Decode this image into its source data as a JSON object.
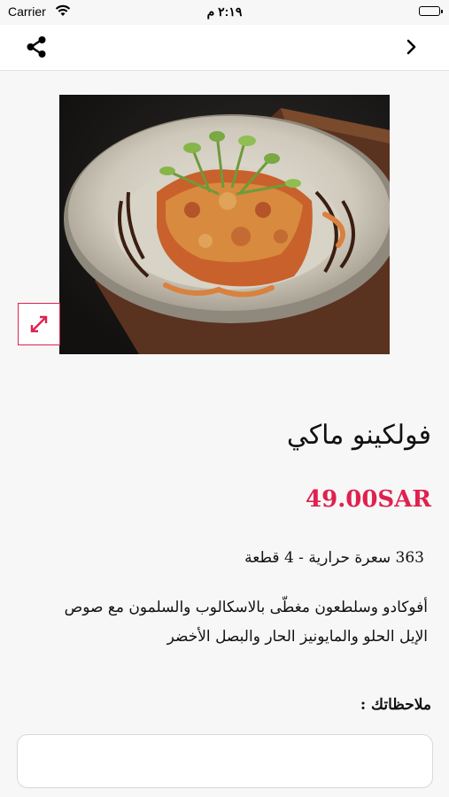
{
  "status_bar": {
    "carrier": "Carrier",
    "time": "٢:١٩ م"
  },
  "nav": {
    "share_icon": "share-icon",
    "forward_icon": "chevron-right-icon"
  },
  "product": {
    "image_alt": "food-photo",
    "name": "فولكينو ماكي",
    "price": "49.00SAR",
    "meta": "363 سعرة حرارية  - 4 قطعة",
    "description": "أفوكادو وسلطعون مغطّى بالاسكالوب والسلمون مع صوص الإيل الحلو والمايونيز الحار والبصل الأخضر"
  },
  "notes": {
    "label": "ملاحظاتك :",
    "placeholder": "",
    "value": ""
  },
  "colors": {
    "accent": "#e0204f",
    "background": "#f7f7f7"
  }
}
